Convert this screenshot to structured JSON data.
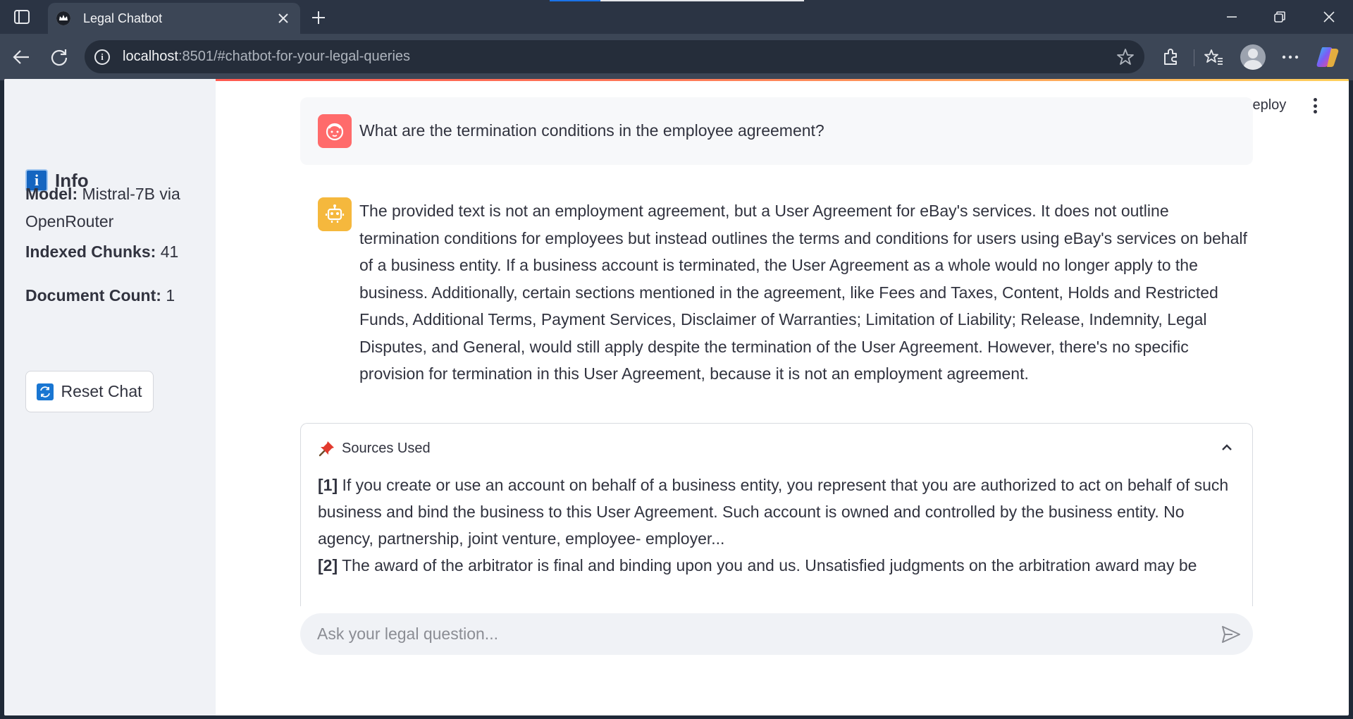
{
  "browser": {
    "tab_title": "Legal Chatbot",
    "url_host": "localhost",
    "url_rest": ":8501/#chatbot-for-your-legal-queries"
  },
  "sidebar": {
    "heading": "Info",
    "model_label": "Model:",
    "model_value": "Mistral-7B via OpenRouter",
    "chunks_label": "Indexed Chunks:",
    "chunks_value": "41",
    "docs_label": "Document Count:",
    "docs_value": "1",
    "reset_label": "Reset Chat"
  },
  "header": {
    "deploy_label": "Deploy"
  },
  "chat": {
    "user_message": "What are the termination conditions in the employee agreement?",
    "bot_message": "The provided text is not an employment agreement, but a User Agreement for eBay's services. It does not outline termination conditions for employees but instead outlines the terms and conditions for users using eBay's services on behalf of a business entity. If a business account is terminated, the User Agreement as a whole would no longer apply to the business. Additionally, certain sections mentioned in the agreement, like Fees and Taxes, Content, Holds and Restricted Funds, Additional Terms, Payment Services, Disclaimer of Warranties; Limitation of Liability; Release, Indemnity, Legal Disputes, and General, would still apply despite the termination of the User Agreement. However, there's no specific provision for termination in this User Agreement, because it is not an employment agreement."
  },
  "sources": {
    "title": "Sources Used",
    "items": [
      {
        "num": "[1]",
        "text": "If you create or use an account on behalf of a business entity, you represent that you are authorized to act on behalf of such business and bind the business to this User Agreement. Such account is owned and controlled by the business entity. No agency, partnership, joint venture, employee- employer..."
      },
      {
        "num": "[2]",
        "text": "The award of the arbitrator is final and binding upon you and us. Unsatisfied judgments on the arbitration award may be"
      }
    ]
  },
  "input": {
    "placeholder": "Ask your legal question..."
  },
  "colors": {
    "accent": "#ff4b4b",
    "user_avatar": "#ff6b6b",
    "bot_avatar": "#f5b83d",
    "sidebar_bg": "#f0f2f6"
  },
  "icons": [
    "tab-actions-icon",
    "streamlit-crown-icon",
    "close-icon",
    "plus-icon",
    "minimize-icon",
    "restore-icon",
    "back-arrow-icon",
    "reload-icon",
    "info-circle-icon",
    "star-icon",
    "extensions-icon",
    "favorites-icon",
    "profile-icon",
    "more-icon",
    "copilot-icon",
    "info-emoji-icon",
    "refresh-emoji-icon",
    "kebab-menu-icon",
    "user-face-icon",
    "robot-icon",
    "pushpin-icon",
    "chevron-up-icon",
    "send-icon"
  ]
}
